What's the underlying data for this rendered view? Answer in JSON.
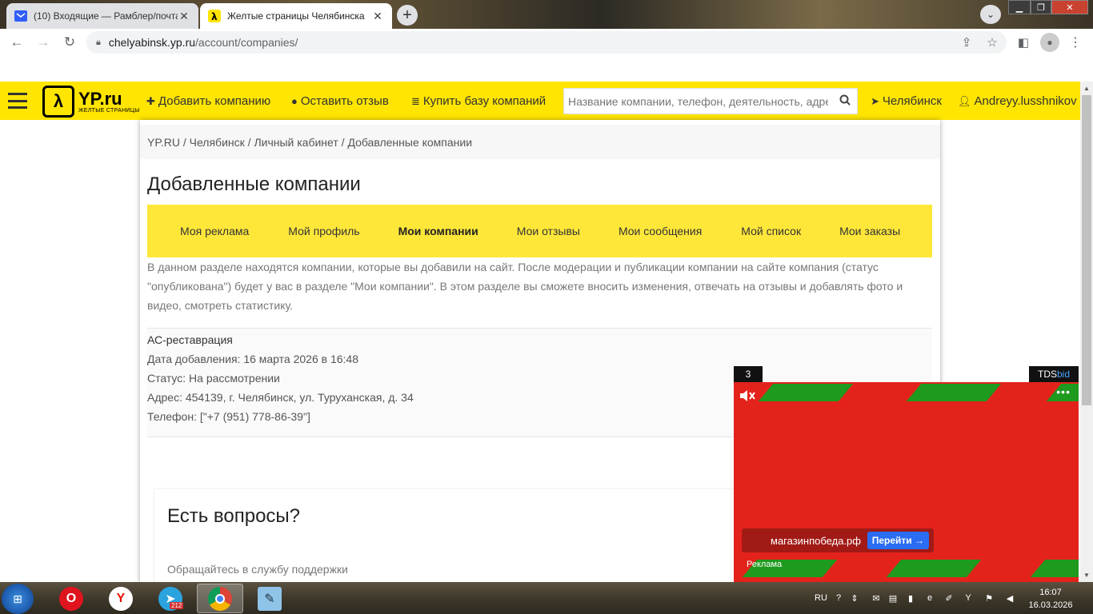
{
  "browser": {
    "tabs": [
      {
        "title": "(10) Входящие — Рамблер/почта",
        "active": false
      },
      {
        "title": "Желтые страницы Челябинска",
        "active": true
      }
    ],
    "url_host": "chelyabinsk.yp.ru",
    "url_path": "/account/companies/"
  },
  "site": {
    "logo_main": "YP.ru",
    "logo_sub": "ЖЕЛТЫЕ СТРАНИЦЫ",
    "add_company": "Добавить компанию",
    "leave_review": "Оставить отзыв",
    "buy_base": "Купить базу компаний",
    "search_placeholder": "Название компании, телефон, деятельность, адрес",
    "city": "Челябинск",
    "user": "Andreyy.lusshnikov"
  },
  "breadcrumb": [
    "YP.RU",
    "Челябинск",
    "Личный кабинет",
    "Добавленные компании"
  ],
  "page_title": "Добавленные компании",
  "tabs": [
    {
      "label": "Моя реклама",
      "active": false
    },
    {
      "label": "Мой профиль",
      "active": false
    },
    {
      "label": "Мои компании",
      "active": true
    },
    {
      "label": "Мои отзывы",
      "active": false
    },
    {
      "label": "Мои сообщения",
      "active": false
    },
    {
      "label": "Мой список",
      "active": false
    },
    {
      "label": "Мои заказы",
      "active": false
    }
  ],
  "intro": "В данном разделе находятся компании, которые вы добавили на сайт. После модерации и публикации компании на сайте компания (статус \"опубликована\") будет у вас в разделе \"Мои компании\". В этом разделе вы сможете вносить изменения, отвечать на отзывы и добавлять фото и видео, смотреть статистику.",
  "company": {
    "name": "АС-реставрация",
    "added": "Дата добавления: 16 марта 2026 в 16:48",
    "status": "Статус: На рассмотрении",
    "address": "Адрес: 454139, г. Челябинск, ул. Туруханская, д. 34",
    "phone": "Телефон: [\"+7 (951) 778-86-39\"]"
  },
  "questions": {
    "title": "Есть вопросы?",
    "subtitle": "Обращайтесь в службу поддержки"
  },
  "ad": {
    "counter": "3",
    "network_a": "TDS",
    "network_b": "bid",
    "site": "магазинпобеда.рф",
    "cta": "Перейти →",
    "label": "Реклама",
    "colors": {
      "bg": "#e3231b",
      "stripe": "#1e9a1e",
      "button": "#2a6df4"
    }
  },
  "taskbar": {
    "lang": "RU",
    "telegram_badge": "212",
    "time": "16:07",
    "date": "16.03.2026"
  }
}
